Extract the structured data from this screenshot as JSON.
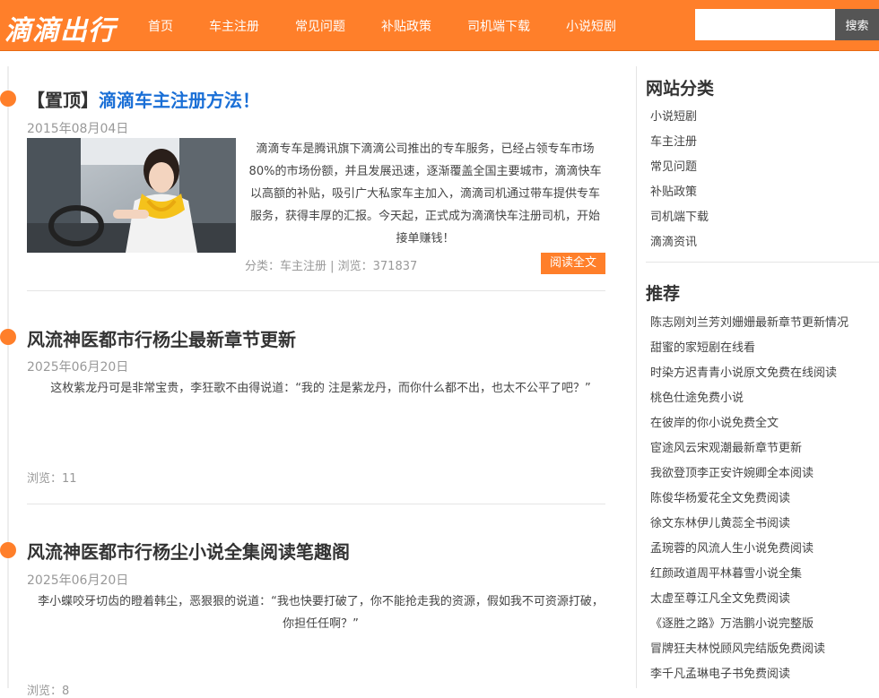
{
  "header": {
    "logo": "滴滴出行",
    "nav": [
      "首页",
      "车主注册",
      "常见问题",
      "补贴政策",
      "司机端下载",
      "小说短剧"
    ],
    "search": {
      "placeholder": "",
      "button_label": "搜索"
    }
  },
  "posts": [
    {
      "prefix": "【置顶】",
      "title": "滴滴车主注册方法！",
      "date": "2015年08月04日",
      "excerpt": "滴滴专车是腾讯旗下滴滴公司推出的专车服务，已经占领专车市场80%的市场份额，并且发展迅速，逐渐覆盖全国主要城市，滴滴快车以高额的补贴，吸引广大私家车主加入，滴滴司机通过带车提供专车服务，获得丰厚的汇报。今天起，正式成为滴滴快车注册司机，开始接单赚钱！",
      "meta": "分类：车主注册 | 浏览：371837",
      "read_more": "阅读全文"
    },
    {
      "title": "风流神医都市行杨尘最新章节更新",
      "date": "2025年06月20日",
      "excerpt": "这枚紫龙丹可是非常宝贵，李狂歌不由得说道：“我的 注是紫龙丹，而你什么都不出，也太不公平了吧？”",
      "meta": "浏览：11"
    },
    {
      "title": "风流神医都市行杨尘小说全集阅读笔趣阁",
      "date": "2025年06月20日",
      "excerpt": "李小蝶咬牙切齿的瞪着韩尘，恶狠狠的说道：“我也快要打破了，你不能抢走我的资源，假如我不可资源打破，你担任任啊？”",
      "meta": "浏览：8"
    }
  ],
  "sidebar": {
    "categories_title": "网站分类",
    "categories": [
      "小说短剧",
      "车主注册",
      "常见问题",
      "补贴政策",
      "司机端下载",
      "滴滴资讯"
    ],
    "recommend_title": "推荐",
    "recommend": [
      "陈志刚刘兰芳刘姗姗最新章节更新情况",
      "甜蜜的家短剧在线看",
      "时染方迟青青小说原文免费在线阅读",
      "桃色仕途免费小说",
      "在彼岸的你小说免费全文",
      "宦途风云宋观潮最新章节更新",
      "我欲登顶李正安许婉卿全本阅读",
      "陈俊华杨爱花全文免费阅读",
      "徐文东林伊儿黄蕊全书阅读",
      "孟琬蓉的风流人生小说免费阅读",
      "红颜政道周平林暮雪小说全集",
      "太虚至尊江凡全文免费阅读",
      "《逐胜之路》万浩鹏小说完整版",
      "冒牌狂夫林悦顾风完结版免费阅读",
      "李千凡孟琳电子书免费阅读"
    ]
  },
  "colors": {
    "accent": "#ff7f2a",
    "link": "#1a6fd6",
    "search_button": "#555555"
  }
}
